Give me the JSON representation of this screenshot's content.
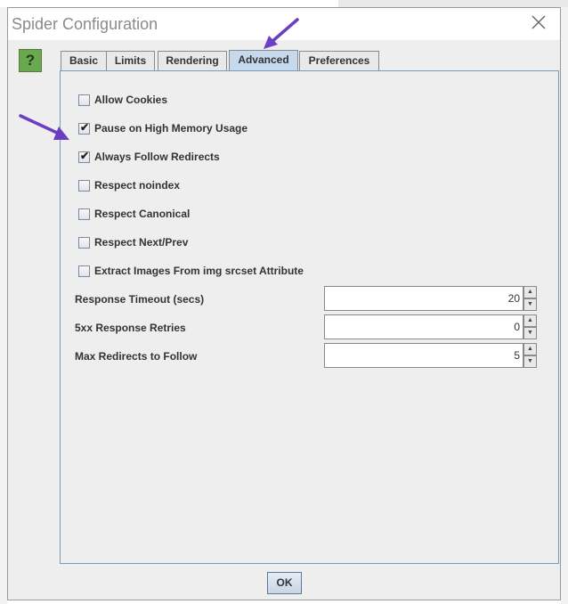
{
  "dialog": {
    "title": "Spider Configuration",
    "help_label": "?",
    "ok_label": "OK"
  },
  "tabs": [
    {
      "label": "Basic"
    },
    {
      "label": "Limits"
    },
    {
      "label": "Rendering"
    },
    {
      "label": "Advanced",
      "active": true
    },
    {
      "label": "Preferences"
    }
  ],
  "checkboxes": [
    {
      "label": "Allow Cookies",
      "checked": false
    },
    {
      "label": "Pause on High Memory Usage",
      "checked": true
    },
    {
      "label": "Always Follow Redirects",
      "checked": true
    },
    {
      "label": "Respect noindex",
      "checked": false
    },
    {
      "label": "Respect Canonical",
      "checked": false
    },
    {
      "label": "Respect Next/Prev",
      "checked": false
    },
    {
      "label": "Extract Images From img srcset Attribute",
      "checked": false
    }
  ],
  "fields": [
    {
      "label": "Response Timeout (secs)",
      "value": "20"
    },
    {
      "label": "5xx Response Retries",
      "value": "0"
    },
    {
      "label": "Max Redirects to Follow",
      "value": "5"
    }
  ],
  "check_mark": "✔",
  "spin_up": "▲",
  "spin_down": "▼",
  "colors": {
    "annotation_arrow": "#6a3fc1",
    "active_tab": "#c7d9ec",
    "help_icon": "#6aa84f"
  }
}
